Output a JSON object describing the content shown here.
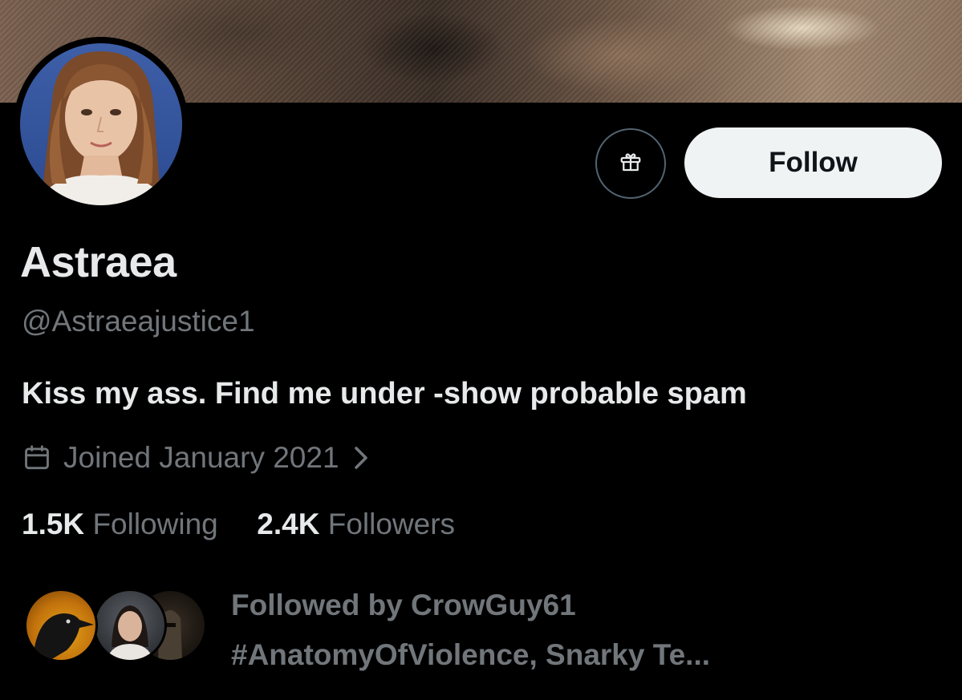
{
  "profile": {
    "name": "Astraea",
    "handle": "@Astraeajustice1",
    "bio": "Kiss my ass. Find me under -show probable spam",
    "joined": "Joined January 2021"
  },
  "actions": {
    "follow_label": "Follow",
    "gift_icon": "gift-icon"
  },
  "stats": {
    "following_count": "1.5K",
    "following_label": "Following",
    "followers_count": "2.4K",
    "followers_label": "Followers"
  },
  "followed_by": {
    "line1": "Followed by CrowGuy61",
    "line2": "#AnatomyOfViolence, Snarky Te..."
  },
  "colors": {
    "background": "#000000",
    "primary_text": "#e7e9ea",
    "secondary_text": "#71767b",
    "follow_button_bg": "#eff3f4",
    "follow_button_text": "#0f1419"
  }
}
